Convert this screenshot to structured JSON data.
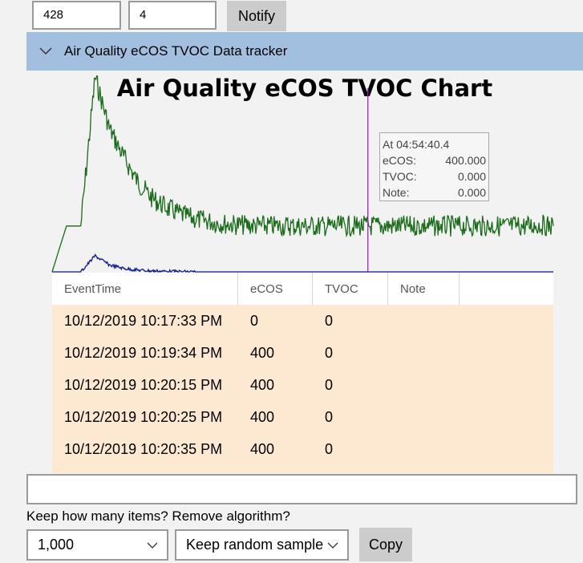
{
  "top_inputs": {
    "first_value": "428",
    "second_value": "4",
    "notify_label": "Notify"
  },
  "expander": {
    "title": "Air Quality eCOS TVOC Data tracker"
  },
  "chart_data": {
    "type": "line",
    "title": "Air Quality eCOS TVOC Chart",
    "series": [
      {
        "name": "eCOS",
        "color": "#1a6b1a",
        "values": [
          0,
          400,
          400,
          1700,
          1250,
          1000,
          780,
          640,
          560,
          500,
          460,
          440,
          420,
          410,
          405,
          400,
          400,
          400,
          400,
          400,
          400,
          400,
          400,
          400,
          400,
          400,
          400,
          400,
          400,
          400,
          400,
          400,
          400,
          400,
          410,
          400
        ]
      },
      {
        "name": "TVOC",
        "color": "#0a1a8c",
        "values": [
          0,
          0,
          0,
          140,
          60,
          30,
          15,
          8,
          4,
          2,
          0,
          0,
          0,
          0,
          0,
          0,
          0,
          0,
          0,
          0,
          0,
          0,
          0,
          0,
          0,
          0,
          0,
          0,
          0,
          0,
          0,
          0,
          0,
          0,
          0,
          0
        ]
      }
    ],
    "ylim": [
      0,
      1700
    ],
    "grid": false,
    "cursor_position": 0.63,
    "cursor_color": "#a020c0",
    "tooltip": {
      "header": "At 04:54:40.4",
      "rows": [
        {
          "key": "eCOS:",
          "value": "400.000"
        },
        {
          "key": "TVOC:",
          "value": "0.000"
        },
        {
          "key": "Note:",
          "value": "0.000"
        }
      ]
    }
  },
  "grid": {
    "columns": [
      "EventTime",
      "eCOS",
      "TVOC",
      "Note"
    ],
    "rows": [
      [
        "10/12/2019 10:17:33 PM",
        "0",
        "0",
        ""
      ],
      [
        "10/12/2019 10:19:34 PM",
        "400",
        "0",
        ""
      ],
      [
        "10/12/2019 10:20:15 PM",
        "400",
        "0",
        ""
      ],
      [
        "10/12/2019 10:20:25 PM",
        "400",
        "0",
        ""
      ],
      [
        "10/12/2019 10:20:35 PM",
        "400",
        "0",
        ""
      ]
    ]
  },
  "status": {
    "text": ""
  },
  "controls": {
    "keep_label": "Keep how many items? Remove algorithm?",
    "count_value": "1,000",
    "algorithm_value": "Keep random sample",
    "copy_label": "Copy"
  },
  "colors": {
    "header_bg": "#a3bfe0",
    "row_bg": "#fde9d2",
    "button_bg": "#cccccc"
  }
}
